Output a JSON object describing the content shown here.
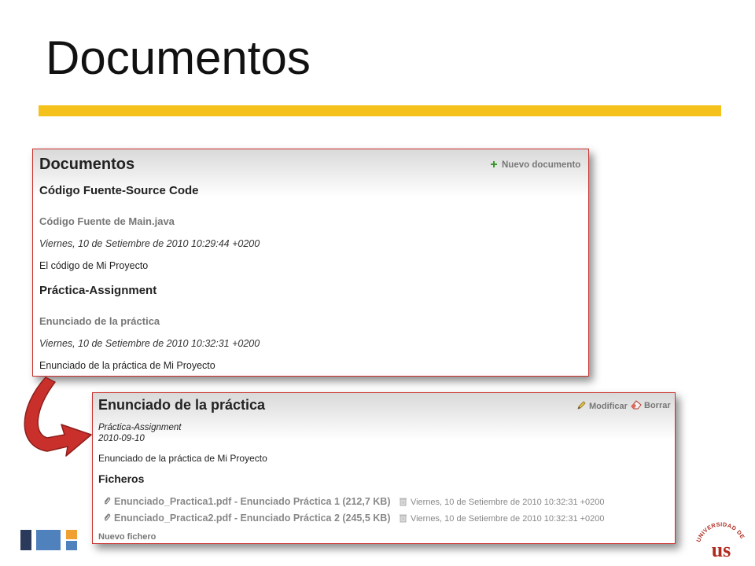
{
  "slide": {
    "title": "Documentos",
    "colors": {
      "accent": "#f5c21b",
      "border": "#c9302c",
      "arrow": "#c9302c",
      "block_dark": "#2b3a5a",
      "block_blue": "#4f81bd",
      "block_orange": "#f0a030"
    }
  },
  "documents_panel": {
    "heading": "Documentos",
    "new_document_label": "Nuevo documento",
    "new_document_icon": "plus-icon",
    "sections": [
      {
        "title": "Código Fuente-Source Code",
        "doc_title": "Código Fuente de Main.java",
        "date": "Viernes, 10 de Setiembre de 2010 10:29:44 +0200",
        "description": "El código de Mi Proyecto"
      },
      {
        "title": "Práctica-Assignment",
        "doc_title": "Enunciado de la práctica",
        "date": "Viernes, 10 de Setiembre de 2010 10:32:31 +0200",
        "description": "Enunciado de la práctica de Mi Proyecto"
      }
    ]
  },
  "detail_panel": {
    "heading": "Enunciado de la práctica",
    "modify_label": "Modificar",
    "delete_label": "Borrar",
    "category": "Práctica-Assignment",
    "date": "2010-09-10",
    "description": "Enunciado de la práctica de Mi Proyecto",
    "files_heading": "Ficheros",
    "files": [
      {
        "link": "Enunciado_Practica1.pdf - Enunciado Práctica 1 (212,7 KB)",
        "date": "Viernes, 10 de Setiembre de 2010 10:32:31 +0200"
      },
      {
        "link": "Enunciado_Practica2.pdf - Enunciado Práctica 2 (245,5 KB)",
        "date": "Viernes, 10 de Setiembre de 2010 10:32:31 +0200"
      }
    ],
    "new_file_label": "Nuevo fichero"
  },
  "logo": {
    "arc_text": "UNIVERSIDAD DE SEVILLA",
    "monogram": "us"
  }
}
